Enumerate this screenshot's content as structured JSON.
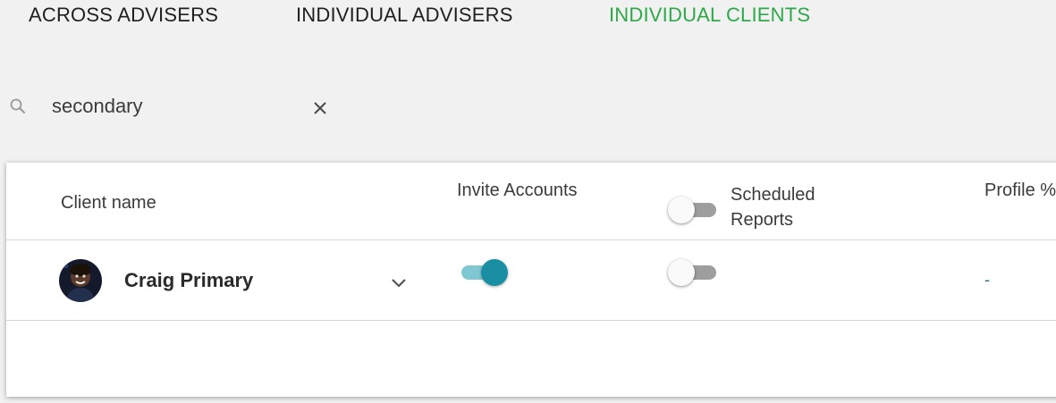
{
  "tabs": [
    {
      "label": "ACROSS ADVISERS",
      "active": false
    },
    {
      "label": "INDIVIDUAL ADVISERS",
      "active": false
    },
    {
      "label": "INDIVIDUAL CLIENTS",
      "active": true
    }
  ],
  "colors": {
    "active_tab": "#2ea84a",
    "inactive_tab": "#1f1f1f",
    "toggle_on": "#1a8fa3",
    "toggle_on_track": "#7fc7d2",
    "toggle_off_track": "#9e9e9e",
    "dash": "#1a6fa0"
  },
  "search": {
    "value": "secondary",
    "icon": "search-icon",
    "clear_icon": "close-icon"
  },
  "table": {
    "headers": {
      "client_name": "Client name",
      "invite_accounts": "Invite Accounts",
      "scheduled_reports": "Scheduled Reports",
      "profile_pct": "Profile %"
    },
    "scheduled_reports_header_toggle": false,
    "rows": [
      {
        "client_name": "Craig Primary",
        "invite_accounts": true,
        "scheduled_reports": false,
        "profile_pct": "-",
        "expand_icon": "chevron-down-icon"
      }
    ]
  }
}
